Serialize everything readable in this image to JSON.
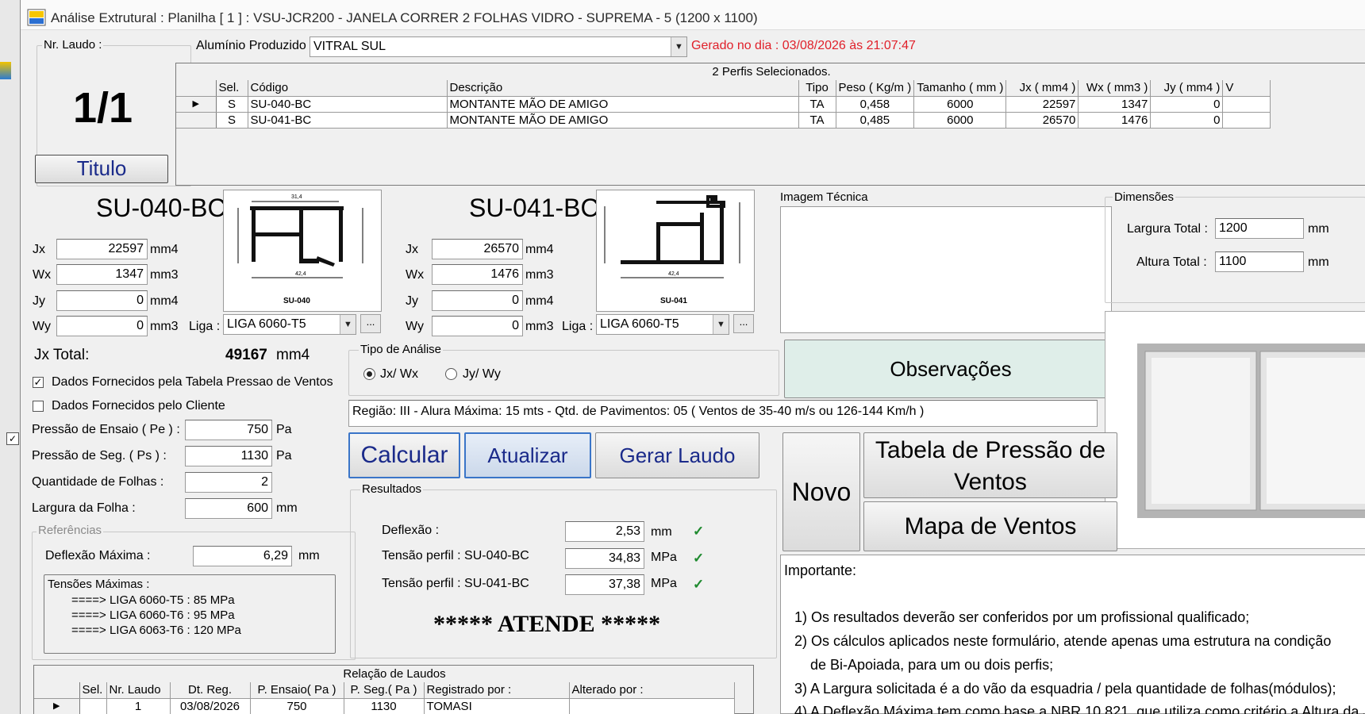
{
  "window": {
    "title": "Análise Extrutural : Planilha [ 1 ] : VSU-JCR200 - JANELA CORRER 2 FOLHAS VIDRO - SUPREMA - 5 (1200 x 1100)"
  },
  "laudo": {
    "group_title": "Nr. Laudo :",
    "number": "1/1",
    "titulo_button": "Titulo"
  },
  "header": {
    "aluminio_label": "Alumínio Produzido por :",
    "aluminio_value": "VITRAL SUL",
    "gerado_text": "Gerado no dia : 03/08/2026 às 21:07:47"
  },
  "perfis_grid": {
    "caption": "2 Perfis Selecionados.",
    "columns": [
      "Sel.",
      "Código",
      "Descrição",
      "Tipo",
      "Peso ( Kg/m )",
      "Tamanho ( mm )",
      "Jx ( mm4 )",
      "Wx ( mm3 )",
      "Jy ( mm4 )",
      "V"
    ],
    "rows": [
      {
        "sel": "S",
        "codigo": "SU-040-BC",
        "descricao": "MONTANTE MÃO DE AMIGO",
        "tipo": "TA",
        "peso": "0,458",
        "tamanho": "6000",
        "jx": "22597",
        "wx": "1347",
        "jy": "0"
      },
      {
        "sel": "S",
        "codigo": "SU-041-BC",
        "descricao": "MONTANTE MÃO DE AMIGO",
        "tipo": "TA",
        "peso": "0,485",
        "tamanho": "6000",
        "jx": "26570",
        "wx": "1476",
        "jy": "0"
      }
    ]
  },
  "perfil1": {
    "code": "SU-040-BC",
    "jx_label": "Jx",
    "jx": "22597",
    "jx_unit": "mm4",
    "wx_label": "Wx",
    "wx": "1347",
    "wx_unit": "mm3",
    "jy_label": "Jy",
    "jy": "0",
    "jy_unit": "mm4",
    "wy_label": "Wy",
    "wy": "0",
    "wy_unit": "mm3",
    "liga_label": "Liga :",
    "liga": "LIGA 6060-T5",
    "drawing_label": "SU-040",
    "dims": [
      "31,4",
      "42,4"
    ]
  },
  "perfil2": {
    "code": "SU-041-BC",
    "jx_label": "Jx",
    "jx": "26570",
    "jx_unit": "mm4",
    "wx_label": "Wx",
    "wx": "1476",
    "wx_unit": "mm3",
    "jy_label": "Jy",
    "jy": "0",
    "jy_unit": "mm4",
    "wy_label": "Wy",
    "wy": "0",
    "wy_unit": "mm3",
    "liga_label": "Liga :",
    "liga": "LIGA 6060-T5",
    "drawing_label": "SU-041",
    "dims": [
      "42,4"
    ]
  },
  "jx_total": {
    "label": "Jx Total:",
    "value": "49167",
    "unit": "mm4"
  },
  "options": {
    "tabela_label": "Dados Fornecidos pela Tabela Pressao de Ventos",
    "tabela_checked": true,
    "cliente_label": "Dados Fornecidos pelo Cliente",
    "cliente_checked": false
  },
  "inputs": {
    "pe_label": "Pressão de Ensaio ( Pe ) :",
    "pe": "750",
    "pe_unit": "Pa",
    "ps_label": "Pressão de Seg. ( Ps ) :",
    "ps": "1130",
    "ps_unit": "Pa",
    "folhas_label": "Quantidade de Folhas :",
    "folhas": "2",
    "largura_label": "Largura da Folha :",
    "largura": "600",
    "largura_unit": "mm"
  },
  "referencias": {
    "group_title": "Referências",
    "deflexao_label": "Deflexão Máxima :",
    "deflexao": "6,29",
    "deflexao_unit": "mm",
    "tensoes_title": "Tensões Máximas :",
    "tensoes": [
      "====> LIGA 6060-T5 : 85 MPa",
      "====> LIGA 6060-T6 : 95 MPa",
      "====> LIGA 6063-T6 : 120 MPa"
    ]
  },
  "analise": {
    "group_title": "Tipo de Análise",
    "opt1": "Jx/ Wx",
    "opt2": "Jy/ Wy",
    "selected": "Jx/ Wx"
  },
  "regiao_text": "Região: III - Alura Máxima: 15 mts - Qtd. de Pavimentos: 05 ( Ventos de 35-40 m/s ou 126-144 Km/h )",
  "buttons": {
    "calcular": "Calcular",
    "atualizar": "Atualizar",
    "gerar_laudo": "Gerar Laudo",
    "observacoes": "Observações",
    "novo": "Novo",
    "tabela_pressao_line1": "Tabela de Pressão de",
    "tabela_pressao_line2": "Ventos",
    "mapa_ventos": "Mapa de Ventos"
  },
  "resultados": {
    "group_title": "Resultados",
    "deflexao_label": "Deflexão :",
    "deflexao": "2,53",
    "deflexao_unit": "mm",
    "tensao1_label": "Tensão perfil : SU-040-BC",
    "tensao1": "34,83",
    "tensao1_unit": "MPa",
    "tensao2_label": "Tensão perfil : SU-041-BC",
    "tensao2": "37,38",
    "tensao2_unit": "MPa",
    "status": "***** ATENDE *****"
  },
  "imagem_tecnica": {
    "group_title": "Imagem Técnica"
  },
  "dimensoes": {
    "group_title": "Dimensões",
    "largura_label": "Largura Total :",
    "largura": "1200",
    "largura_unit": "mm",
    "altura_label": "Altura Total :",
    "altura": "1100",
    "altura_unit": "mm"
  },
  "importante": {
    "title": "Importante:",
    "lines": [
      "1) Os resultados deverão ser conferidos por um profissional qualificado;",
      "2) Os cálculos aplicados neste formulário, atende apenas uma estrutura na condição",
      "    de Bi-Apoiada, para um ou dois perfis;",
      "3) A Largura solicitada é a do vão da esquadria / pela quantidade de folhas(módulos);",
      "4) A Deflexão Máxima tem como base a NBR 10.821, que utiliza como critério a Altura da Ja"
    ]
  },
  "laudos_grid": {
    "caption": "Relação de Laudos",
    "columns": [
      "Sel.",
      "Nr. Laudo",
      "Dt. Reg.",
      "P. Ensaio( Pa )",
      "P. Seg.( Pa )",
      "Registrado por :",
      "Alterado por :"
    ],
    "rows": [
      {
        "sel": "",
        "nr": "1",
        "dt": "03/08/2026",
        "pe": "750",
        "ps": "1130",
        "registrado": "TOMASI",
        "alterado": ""
      }
    ]
  },
  "colors": {
    "gerado": "#e0202a",
    "button_text": "#1a2a8a",
    "ok": "#1e8a2e",
    "observacoes_bg": "#dfeee9"
  }
}
